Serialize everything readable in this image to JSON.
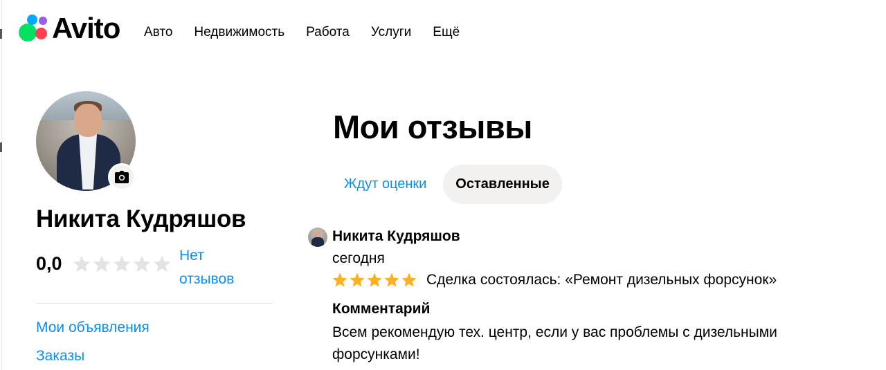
{
  "header": {
    "logo_text": "Avito",
    "nav": [
      "Авто",
      "Недвижимость",
      "Работа",
      "Услуги",
      "Ещё"
    ]
  },
  "profile": {
    "name": "Никита Кудряшов",
    "rating": "0,0",
    "stars_filled": 0,
    "stars_total": 5,
    "reviews_link": "Нет отзывов",
    "links": [
      "Мои объявления",
      "Заказы"
    ]
  },
  "main": {
    "title": "Мои отзывы",
    "tabs": [
      {
        "label": "Ждут оценки",
        "active": false
      },
      {
        "label": "Оставленные",
        "active": true
      }
    ],
    "review": {
      "author": "Никита Кудряшов",
      "date": "сегодня",
      "stars_filled": 5,
      "deal": "Сделка состоялась: «Ремонт дизельных форсунок»",
      "comment_title": "Комментарий",
      "comment": "Всем рекомендую тех. центр, если у вас проблемы с дизельными форсунками!"
    }
  },
  "colors": {
    "link": "#0a8ff0",
    "star_filled": "#ffb021",
    "star_empty": "#e3e3e3",
    "tab_active_bg": "#f2f1f0"
  },
  "icons": {
    "camera": "camera-icon",
    "star": "star-icon"
  }
}
